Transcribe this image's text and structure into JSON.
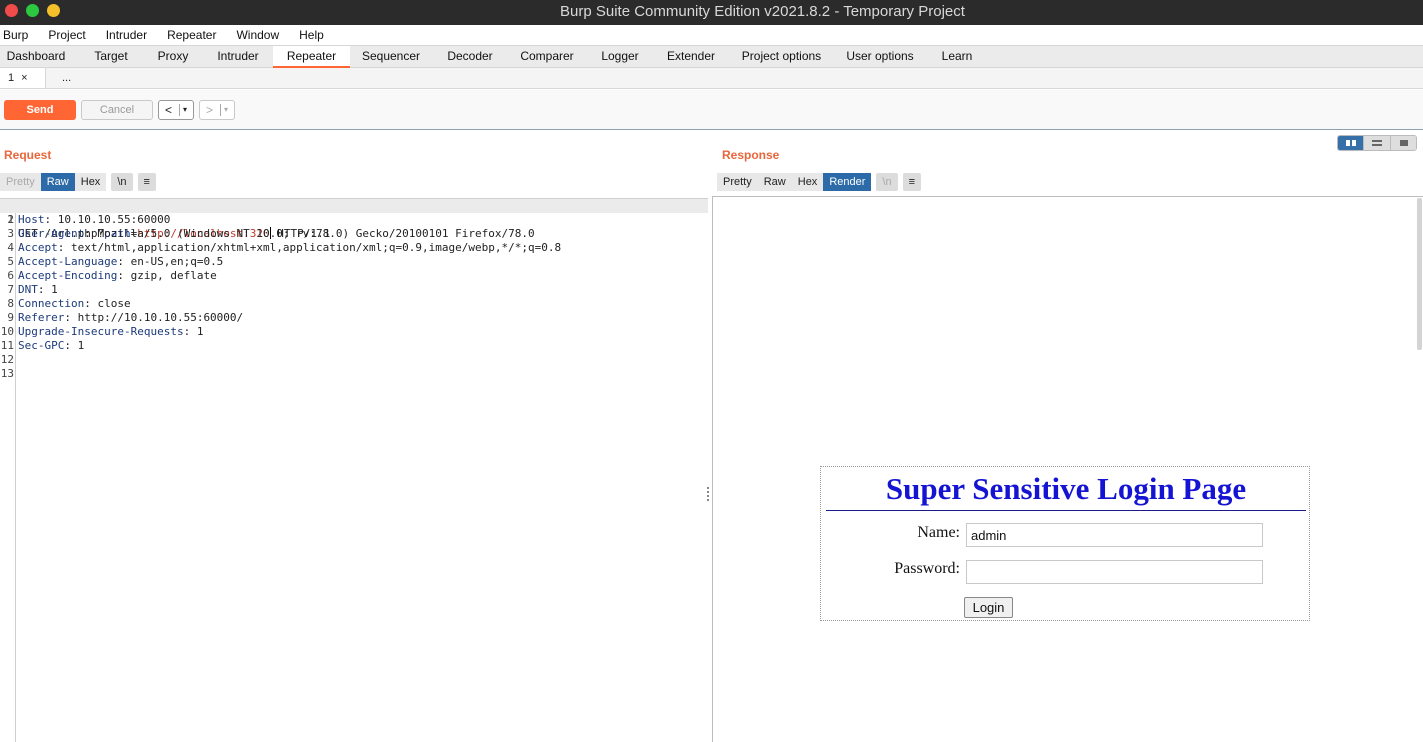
{
  "window": {
    "title": "Burp Suite Community Edition v2021.8.2 - Temporary Project"
  },
  "menubar": [
    "Burp",
    "Project",
    "Intruder",
    "Repeater",
    "Window",
    "Help"
  ],
  "main_tabs": [
    "Dashboard",
    "Target",
    "Proxy",
    "Intruder",
    "Repeater",
    "Sequencer",
    "Decoder",
    "Comparer",
    "Logger",
    "Extender",
    "Project options",
    "User options",
    "Learn"
  ],
  "active_main_tab": "Repeater",
  "sub_tabs": {
    "active_label": "1",
    "close_glyph": "×",
    "more_label": "..."
  },
  "toolbar": {
    "send_label": "Send",
    "cancel_label": "Cancel",
    "back_glyph": "<",
    "forward_glyph": ">",
    "dropdown_glyph": "▾"
  },
  "request": {
    "title": "Request",
    "format_buttons": {
      "pretty": "Pretty",
      "raw": "Raw",
      "hex": "Hex",
      "newline": "\\n",
      "menu": "≡"
    },
    "request_line": {
      "method_path": "GET /url.php?",
      "param_name": "path",
      "equals": "=",
      "param_value": "http://localhost:320",
      "protocol": " HTTP/1.1"
    },
    "headers": [
      {
        "name": "Host",
        "value": "10.10.10.55:60000"
      },
      {
        "name": "User-Agent",
        "value": "Mozilla/5.0 (Windows NT 10.0; rv:78.0) Gecko/20100101 Firefox/78.0"
      },
      {
        "name": "Accept",
        "value": "text/html,application/xhtml+xml,application/xml;q=0.9,image/webp,*/*;q=0.8"
      },
      {
        "name": "Accept-Language",
        "value": "en-US,en;q=0.5"
      },
      {
        "name": "Accept-Encoding",
        "value": "gzip, deflate"
      },
      {
        "name": "DNT",
        "value": "1"
      },
      {
        "name": "Connection",
        "value": "close"
      },
      {
        "name": "Referer",
        "value": "http://10.10.10.55:60000/"
      },
      {
        "name": "Upgrade-Insecure-Requests",
        "value": "1"
      },
      {
        "name": "Sec-GPC",
        "value": "1"
      }
    ],
    "line_numbers": [
      "1",
      "2",
      "3",
      "4",
      "5",
      "6",
      "7",
      "8",
      "9",
      "10",
      "11",
      "12",
      "13"
    ]
  },
  "response": {
    "title": "Response",
    "format_buttons": {
      "pretty": "Pretty",
      "raw": "Raw",
      "hex": "Hex",
      "render": "Render",
      "newline": "\\n",
      "menu": "≡"
    },
    "render": {
      "heading": "Super Sensitive Login Page",
      "name_label": "Name:",
      "name_value": "admin",
      "password_label": "Password:",
      "password_value": "",
      "login_button": "Login"
    }
  },
  "colors": {
    "accent": "#ff6633",
    "selected_button": "#2d6aa8",
    "render_heading": "#1414d2"
  },
  "icons": [
    "close-x-icon",
    "back-arrow-icon",
    "forward-arrow-icon",
    "dropdown-caret-icon",
    "menu-lines-icon",
    "split-view-icon",
    "horizontal-view-icon",
    "single-view-icon"
  ]
}
